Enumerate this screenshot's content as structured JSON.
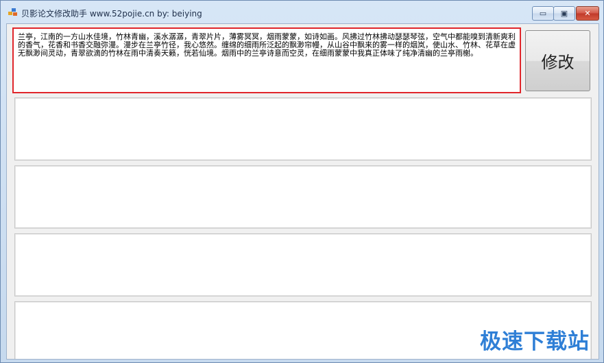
{
  "window": {
    "title": "贝影论文修改助手 www.52pojie.cn by: beiying",
    "controls": {
      "minimize": "▭",
      "maximize": "▣",
      "close": "✕"
    }
  },
  "input": {
    "text": "兰亭，江南的一方山水佳境，竹林青幽，溪水潺潺，青翠片片，薄雾冥冥，烟雨蒙蒙，如诗如画。风拂过竹林拂动瑟瑟琴弦，空气中都能嗅到清新爽利的香气，花香和书香交融弥漫。漫步在兰亭竹径，我心悠然。缠绵的细雨所泛起的飘渺帘幔，从山谷中飘来的雾一样的烟岚，使山水、竹林、花草在虚无飘渺间灵动，青翠欲滴的竹林在雨中清奏天籁，恍若仙境。烟雨中的兰亭诗意而空灵，在细雨蒙蒙中我真正体味了纯净清幽的兰亭雨榭。"
  },
  "modify_button": {
    "label": "修改"
  },
  "outputs": [
    "",
    "",
    "",
    ""
  ],
  "watermark": "极速下载站",
  "colors": {
    "accent_border": "#e0262b",
    "watermark": "#2f7fd6"
  },
  "icons": {
    "app": "app-icon"
  }
}
